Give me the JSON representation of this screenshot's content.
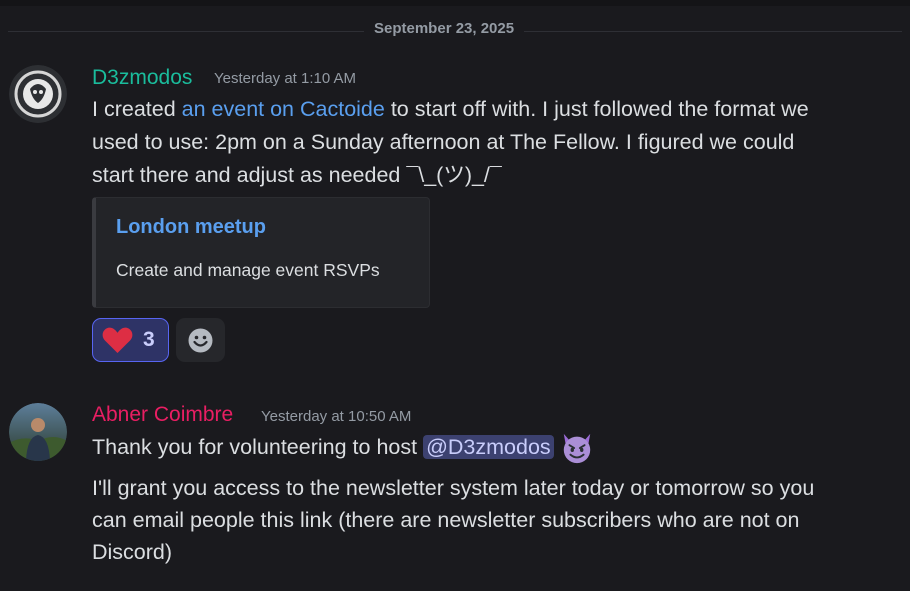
{
  "date_divider": "September 23, 2025",
  "messages": [
    {
      "author": "D3zmodos",
      "author_color": "#1abc9c",
      "timestamp": "Yesterday at 1:10 AM",
      "line1_prefix": "I created ",
      "link_text": "an event on Cactoide",
      "line1_suffix": " to start off with. I just followed the format we",
      "line2": "used to use: 2pm on a Sunday afternoon at The Fellow. I figured we could",
      "line3": "start there and adjust as needed ¯\\_(ツ)_/¯",
      "embed": {
        "title": "London meetup",
        "description": "Create and manage event RSVPs"
      },
      "reactions": [
        {
          "emoji": "heart",
          "count": "3"
        }
      ]
    },
    {
      "author": "Abner Coimbre",
      "author_color": "#e91e63",
      "timestamp": "Yesterday at 10:50 AM",
      "line1_prefix": "Thank you for volunteering to host ",
      "mention": "@D3zmodos",
      "emoji": "smiling-imp",
      "line2": "I'll grant you access to the newsletter system later today or tomorrow so you",
      "line3": "can email people this link (there are newsletter subscribers who are not on",
      "line4": "Discord)"
    }
  ],
  "colors": {
    "background": "#1a1a1e",
    "link": "#5a9fef",
    "mention_bg": "#3c4170",
    "muted": "#949ba4"
  }
}
